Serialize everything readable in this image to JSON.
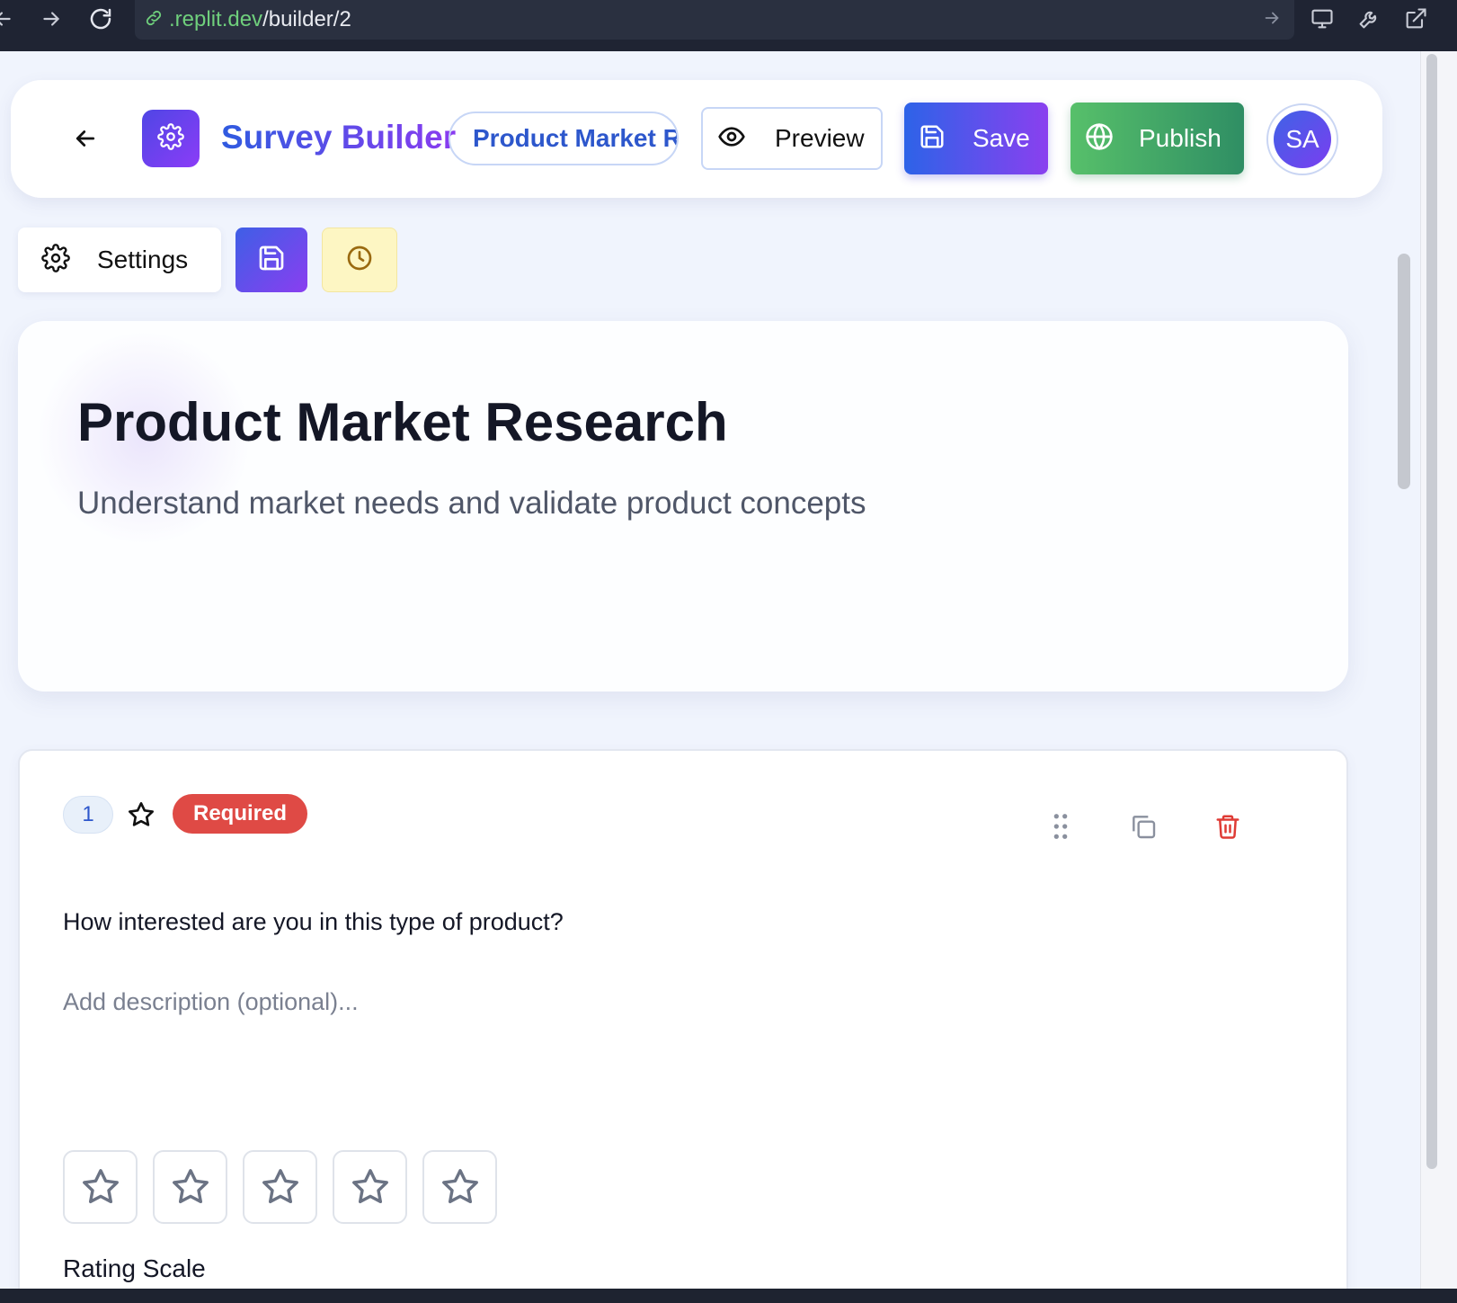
{
  "browser": {
    "url_domain": ".replit.dev",
    "url_path": "/builder/2"
  },
  "header": {
    "app_title": "Survey Builder",
    "survey_pill": "Product Market Research",
    "preview_label": "Preview",
    "save_label": "Save",
    "publish_label": "Publish",
    "avatar_initials": "SA"
  },
  "toolbar": {
    "settings_label": "Settings"
  },
  "survey": {
    "title": "Product Market Research",
    "description": "Understand market needs and validate product concepts"
  },
  "question": {
    "number": "1",
    "required_label": "Required",
    "text": "How interested are you in this type of product?",
    "description_placeholder": "Add description (optional)...",
    "rating_stars": 5,
    "scale_label": "Rating Scale"
  },
  "colors": {
    "brand_gradient_start": "#2f5be0",
    "brand_gradient_end": "#8a3cf0",
    "publish_green": "#57c06a",
    "required_red": "#df4a45",
    "history_yellow": "#fdf6c3"
  }
}
